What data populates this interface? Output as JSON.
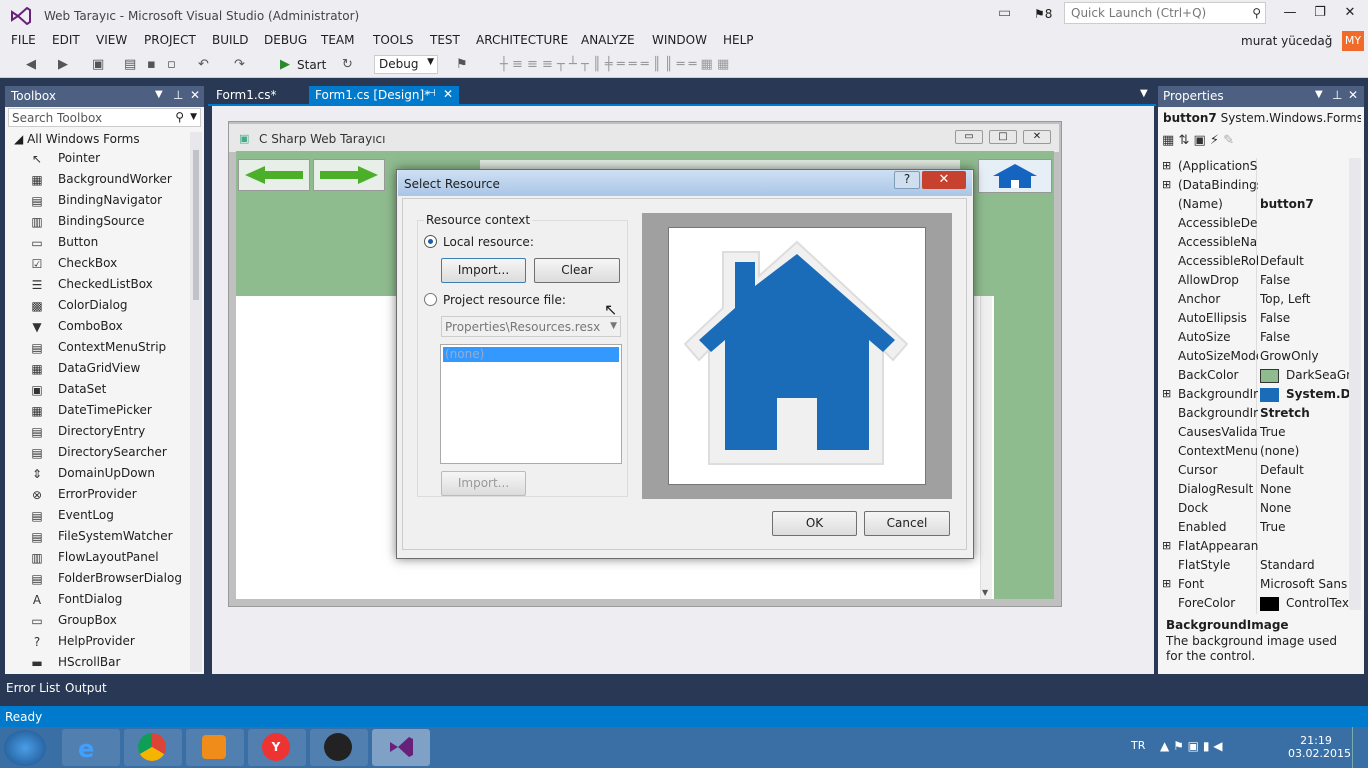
{
  "window": {
    "title": "Web Tarayıc - Microsoft Visual Studio (Administrator)",
    "flag_count": "8",
    "quick_launch": "Quick Launch (Ctrl+Q)"
  },
  "menu": [
    "FILE",
    "EDIT",
    "VIEW",
    "PROJECT",
    "BUILD",
    "DEBUG",
    "TEAM",
    "TOOLS",
    "TEST",
    "ARCHITECTURE",
    "ANALYZE",
    "WINDOW",
    "HELP"
  ],
  "user": {
    "name": "murat yücedağ",
    "initials": "MY"
  },
  "toolbar": {
    "start": "Start",
    "config": "Debug"
  },
  "toolbox": {
    "title": "Toolbox",
    "search": "Search Toolbox",
    "group": "All Windows Forms",
    "items": [
      "Pointer",
      "BackgroundWorker",
      "BindingNavigator",
      "BindingSource",
      "Button",
      "CheckBox",
      "CheckedListBox",
      "ColorDialog",
      "ComboBox",
      "ContextMenuStrip",
      "DataGridView",
      "DataSet",
      "DateTimePicker",
      "DirectoryEntry",
      "DirectorySearcher",
      "DomainUpDown",
      "ErrorProvider",
      "EventLog",
      "FileSystemWatcher",
      "FlowLayoutPanel",
      "FolderBrowserDialog",
      "FontDialog",
      "GroupBox",
      "HelpProvider",
      "HScrollBar"
    ]
  },
  "tabs": {
    "tab1": "Form1.cs*",
    "tab2": "Form1.cs [Design]*"
  },
  "form": {
    "title": "C Sharp Web Tarayıcı"
  },
  "dialog": {
    "title": "Select Resource",
    "help": "?",
    "context_label": "Resource context",
    "local": "Local resource:",
    "import": "Import...",
    "clear": "Clear",
    "project_file": "Project resource file:",
    "resx": "Properties\\Resources.resx",
    "list_item": "(none)",
    "import2": "Import...",
    "ok": "OK",
    "cancel": "Cancel"
  },
  "properties": {
    "title": "Properties",
    "object": "button7",
    "type": "System.Windows.Forms.I",
    "rows": [
      {
        "name": "(ApplicationSe",
        "value": ""
      },
      {
        "name": "(DataBindings)",
        "value": ""
      },
      {
        "name": "(Name)",
        "value": "button7"
      },
      {
        "name": "AccessibleDesc",
        "value": ""
      },
      {
        "name": "AccessibleNam",
        "value": ""
      },
      {
        "name": "AccessibleRole",
        "value": "Default"
      },
      {
        "name": "AllowDrop",
        "value": "False"
      },
      {
        "name": "Anchor",
        "value": "Top, Left"
      },
      {
        "name": "AutoEllipsis",
        "value": "False"
      },
      {
        "name": "AutoSize",
        "value": "False"
      },
      {
        "name": "AutoSizeMode",
        "value": "GrowOnly"
      },
      {
        "name": "BackColor",
        "value": "DarkSeaGre"
      },
      {
        "name": "BackgroundIm",
        "value": "System.Dr"
      },
      {
        "name": "BackgroundIm",
        "value": "Stretch"
      },
      {
        "name": "CausesValidati",
        "value": "True"
      },
      {
        "name": "ContextMenuS",
        "value": "(none)"
      },
      {
        "name": "Cursor",
        "value": "Default"
      },
      {
        "name": "DialogResult",
        "value": "None"
      },
      {
        "name": "Dock",
        "value": "None"
      },
      {
        "name": "Enabled",
        "value": "True"
      },
      {
        "name": "FlatAppearanc",
        "value": ""
      },
      {
        "name": "FlatStyle",
        "value": "Standard"
      },
      {
        "name": "Font",
        "value": "Microsoft Sans S"
      },
      {
        "name": "ForeColor",
        "value": "ControlTex"
      }
    ],
    "desc_title": "BackgroundImage",
    "desc": "The background image used for the control."
  },
  "bottom": {
    "error_list": "Error List",
    "output": "Output"
  },
  "status": "Ready",
  "tray": {
    "lang": "TR",
    "time": "21:19",
    "date": "03.02.2015"
  }
}
